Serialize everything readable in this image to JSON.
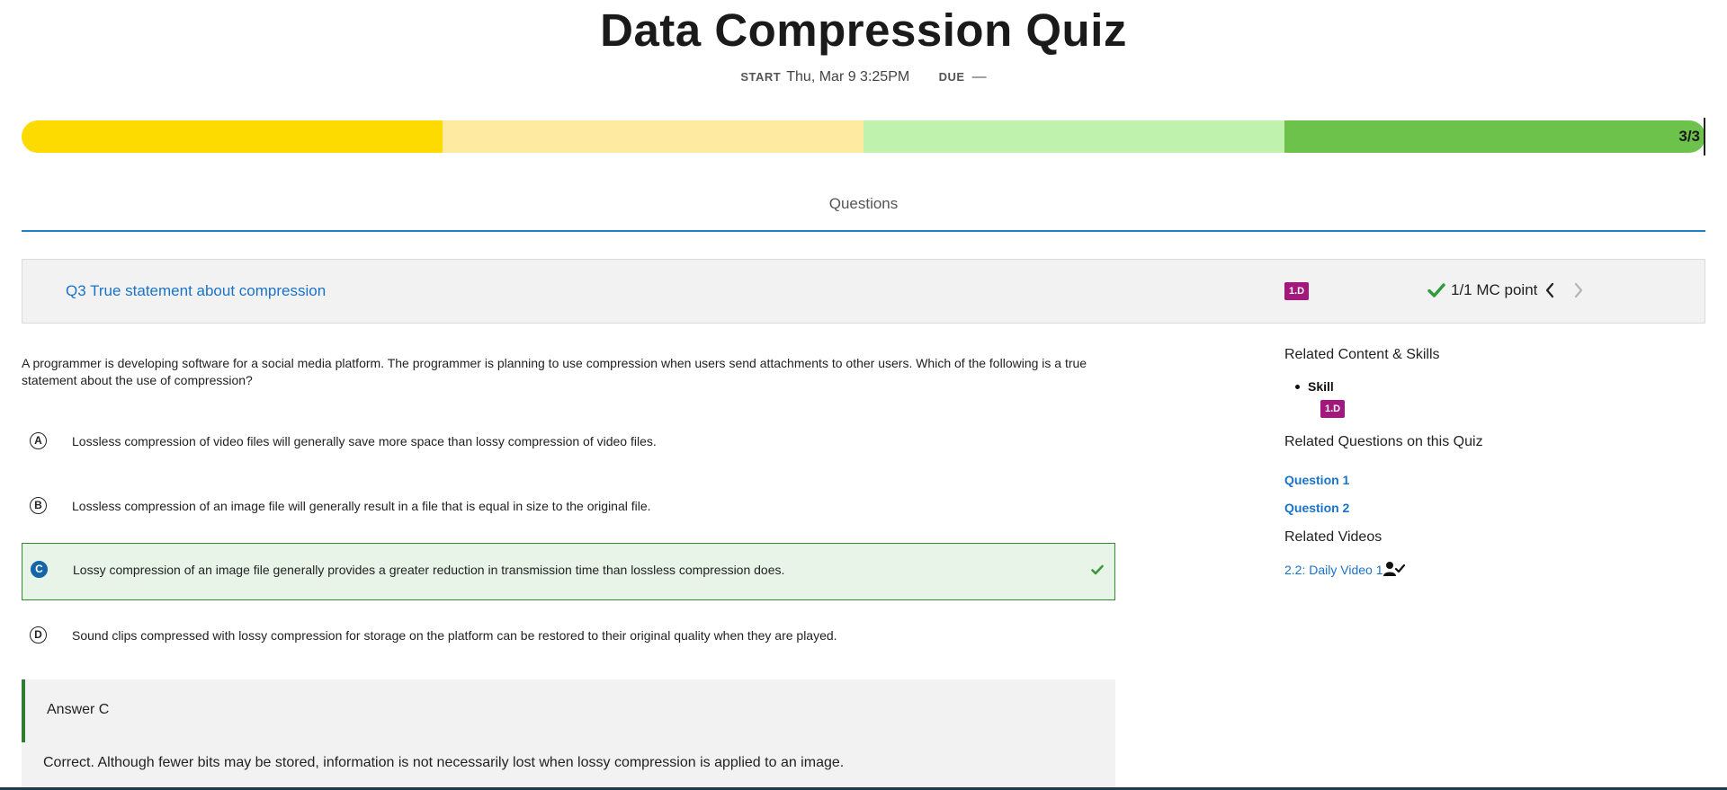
{
  "page": {
    "title": "Data Compression Quiz"
  },
  "dates": {
    "start_label": "START",
    "start_value": "Thu, Mar 9 3:25PM",
    "due_label": "DUE",
    "due_value": "—"
  },
  "progress": {
    "count": "3/3",
    "fraction": 1.0,
    "colors": [
      "#fedb00",
      "#feeaa0",
      "#bff2ac",
      "#6cc24a"
    ]
  },
  "tabs": [
    {
      "label": "Questions",
      "active": true
    }
  ],
  "question": {
    "title": "Q3 True statement about compression",
    "skill_badge": "1.D",
    "score": "1/1 MC point",
    "prompt": "A programmer is developing software for a social media platform. The programmer is planning to use compression when users send attachments to other users. Which of the following is a true statement about the use of compression?",
    "choices": [
      {
        "letter": "A",
        "text": "Lossless compression of video files will generally save more space than lossy compression of video files.",
        "correct": false
      },
      {
        "letter": "B",
        "text": "Lossless compression of an image file will generally result in a file that is equal in size to the original file.",
        "correct": false
      },
      {
        "letter": "C",
        "text": "Lossy compression of an image file generally provides a greater reduction in transmission time than lossless compression does.",
        "correct": true
      },
      {
        "letter": "D",
        "text": "Sound clips compressed with lossy compression for storage on the platform can be restored to their original quality when they are played.",
        "correct": false
      }
    ]
  },
  "answer": {
    "title": "Answer C",
    "explanation": "Correct. Although fewer bits may be stored, information is not necessarily lost when lossy compression is applied to an image."
  },
  "sidebar": {
    "related_content_heading": "Related Content & Skills",
    "skill_label": "Skill",
    "skill_badge": "1.D",
    "related_questions_heading": "Related Questions on this Quiz",
    "related_questions": [
      "Question 1",
      "Question 2"
    ],
    "related_videos_heading": "Related Videos",
    "video_link": "2.2: Daily Video 1"
  },
  "colors": {
    "accent_blue": "#1a73c8",
    "badge_magenta": "#a3187c",
    "correct_green": "#2e8b2e"
  }
}
